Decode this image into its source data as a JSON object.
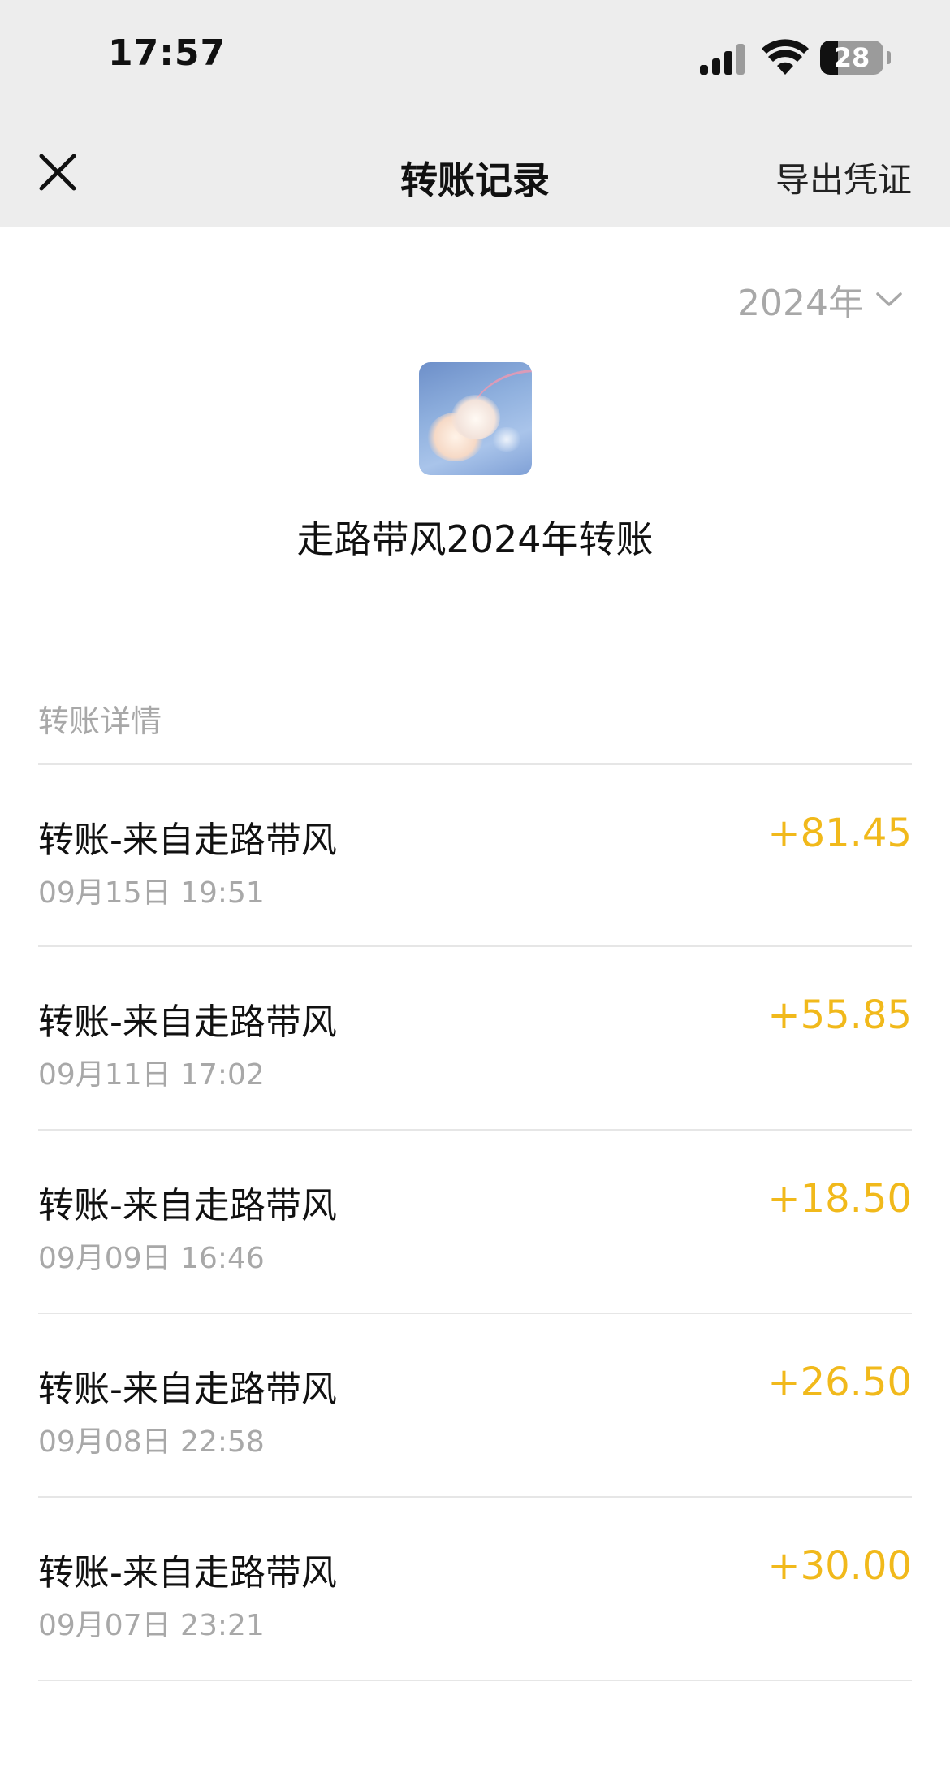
{
  "status_bar": {
    "time": "17:57",
    "battery": "28"
  },
  "nav": {
    "title": "转账记录",
    "export_label": "导出凭证"
  },
  "year_picker": {
    "label": "2024年"
  },
  "summary": {
    "title": "走路带风2024年转账"
  },
  "section": {
    "label": "转账详情"
  },
  "colors": {
    "amount": "#f1b91b",
    "nav_bg": "#ededed",
    "muted_text": "#a8a8a8"
  },
  "records": [
    {
      "title": "转账-来自走路带风",
      "date": "09月15日 19:51",
      "amount": "+81.45"
    },
    {
      "title": "转账-来自走路带风",
      "date": "09月11日 17:02",
      "amount": "+55.85"
    },
    {
      "title": "转账-来自走路带风",
      "date": "09月09日 16:46",
      "amount": "+18.50"
    },
    {
      "title": "转账-来自走路带风",
      "date": "09月08日 22:58",
      "amount": "+26.50"
    },
    {
      "title": "转账-来自走路带风",
      "date": "09月07日 23:21",
      "amount": "+30.00"
    }
  ]
}
